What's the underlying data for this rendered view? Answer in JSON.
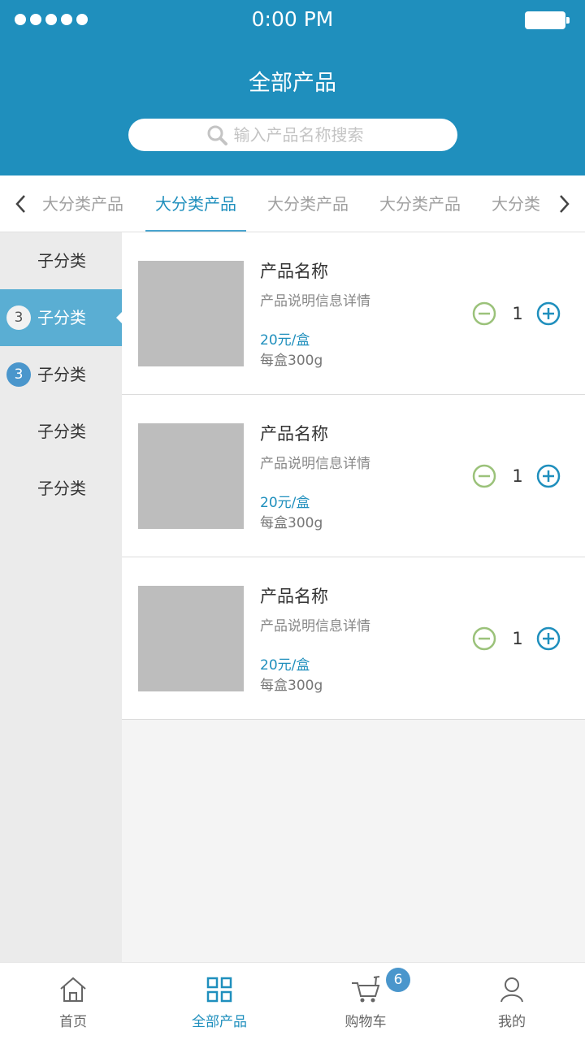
{
  "status_bar": {
    "time": "0:00 PM"
  },
  "header": {
    "title": "全部产品",
    "search_placeholder": "输入产品名称搜索"
  },
  "tabs": [
    {
      "label": "大分类产品",
      "active": false
    },
    {
      "label": "大分类产品",
      "active": true
    },
    {
      "label": "大分类产品",
      "active": false
    },
    {
      "label": "大分类产品",
      "active": false
    },
    {
      "label": "大分类",
      "active": false
    }
  ],
  "sidebar": {
    "items": [
      {
        "label": "子分类",
        "badge": "",
        "active": false
      },
      {
        "label": "子分类",
        "badge": "3",
        "active": true
      },
      {
        "label": "子分类",
        "badge": "3",
        "active": false
      },
      {
        "label": "子分类",
        "badge": "",
        "active": false
      },
      {
        "label": "子分类",
        "badge": "",
        "active": false
      }
    ]
  },
  "products": [
    {
      "name": "产品名称",
      "description": "产品说明信息详情",
      "price": "20元/盒",
      "weight": "每盒300g",
      "quantity": "1"
    },
    {
      "name": "产品名称",
      "description": "产品说明信息详情",
      "price": "20元/盒",
      "weight": "每盒300g",
      "quantity": "1"
    },
    {
      "name": "产品名称",
      "description": "产品说明信息详情",
      "price": "20元/盒",
      "weight": "每盒300g",
      "quantity": "1"
    }
  ],
  "bottom_nav": {
    "items": [
      {
        "label": "首页",
        "icon": "home-icon",
        "active": false
      },
      {
        "label": "全部产品",
        "icon": "grid-icon",
        "active": true
      },
      {
        "label": "购物车",
        "icon": "cart-icon",
        "active": false
      },
      {
        "label": "我的",
        "icon": "user-icon",
        "active": false
      }
    ],
    "cart_badge": "6"
  },
  "colors": {
    "primary": "#1f8fbd",
    "sidebar_active": "#5aaed3",
    "badge": "#4a96cc",
    "minus_green": "#9bc27a",
    "placeholder_gray": "#bdbdbd"
  }
}
